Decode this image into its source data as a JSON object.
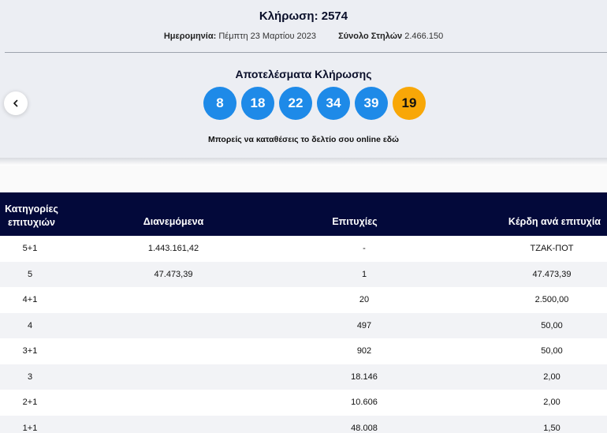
{
  "header": {
    "draw_title": "Κλήρωση: 2574",
    "date_label": "Ημερομηνία:",
    "date_value": "Πέμπτη 23 Μαρτίου 2023",
    "columns_label": "Σύνολο Στηλών",
    "columns_value": "2.466.150"
  },
  "results": {
    "title": "Αποτελέσματα Κλήρωσης",
    "numbers": [
      "8",
      "18",
      "22",
      "34",
      "39"
    ],
    "bonus": "19",
    "online_note": "Μπορείς να καταθέσεις το δελτίο σου online",
    "online_link": "εδώ"
  },
  "table": {
    "headers": {
      "category": "Κατηγορίες επιτυχιών",
      "distributed": "Διανεμόμενα",
      "winners": "Επιτυχίες",
      "prize_per_winner": "Κέρδη ανά επιτυχία"
    },
    "rows": [
      {
        "category": "5+1",
        "distributed": "1.443.161,42",
        "winners": "-",
        "prize": "ΤΖΑΚ-ΠΟΤ"
      },
      {
        "category": "5",
        "distributed": "47.473,39",
        "winners": "1",
        "prize": "47.473,39"
      },
      {
        "category": "4+1",
        "distributed": "",
        "winners": "20",
        "prize": "2.500,00"
      },
      {
        "category": "4",
        "distributed": "",
        "winners": "497",
        "prize": "50,00"
      },
      {
        "category": "3+1",
        "distributed": "",
        "winners": "902",
        "prize": "50,00"
      },
      {
        "category": "3",
        "distributed": "",
        "winners": "18.146",
        "prize": "2,00"
      },
      {
        "category": "2+1",
        "distributed": "",
        "winners": "10.606",
        "prize": "2,00"
      },
      {
        "category": "1+1",
        "distributed": "",
        "winners": "48.008",
        "prize": "1,50"
      }
    ]
  },
  "colors": {
    "ball": "#1e8ae8",
    "bonus_ball": "#f8a707",
    "table_header": "#03093a"
  },
  "icons": {
    "prev": "chevron-left-icon"
  }
}
